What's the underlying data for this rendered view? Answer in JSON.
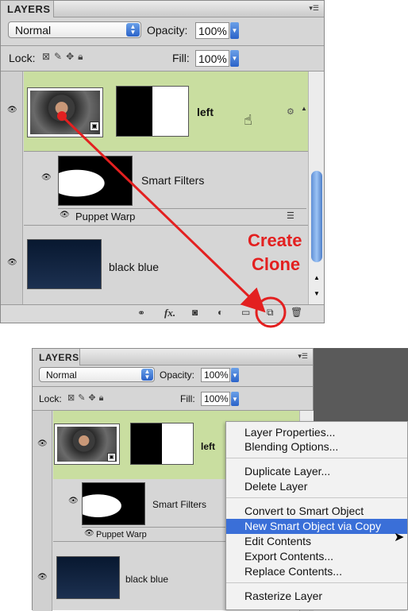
{
  "panel1": {
    "tab_label": "LAYERS",
    "blend_mode": "Normal",
    "opacity_label": "Opacity:",
    "opacity_value": "100%",
    "lock_label": "Lock:",
    "fill_label": "Fill:",
    "fill_value": "100%",
    "layers": {
      "left_name": "left",
      "smart_filters": "Smart Filters",
      "puppet_warp": "Puppet Warp",
      "black_blue": "black blue"
    },
    "annotation": {
      "line1": "Create",
      "line2": "Clone"
    },
    "footer_fx": "fx."
  },
  "panel2": {
    "tab_label": "LAYERS",
    "blend_mode": "Normal",
    "opacity_label": "Opacity:",
    "opacity_value": "100%",
    "lock_label": "Lock:",
    "fill_label": "Fill:",
    "fill_value": "100%",
    "layers": {
      "left_name": "left",
      "smart_filters": "Smart Filters",
      "puppet_warp": "Puppet Warp",
      "black_blue": "black blue"
    }
  },
  "context_menu": {
    "items": [
      "Layer Properties...",
      "Blending Options...",
      "Duplicate Layer...",
      "Delete Layer",
      "Convert to Smart Object",
      "New Smart Object via Copy",
      "Edit Contents",
      "Export Contents...",
      "Replace Contents...",
      "Rasterize Layer"
    ],
    "highlighted_index": 5
  },
  "colors": {
    "selected_row": "#c9dea0",
    "annotation_red": "#e32020",
    "menu_highlight": "#3a6fd8"
  },
  "icons": [
    "eye-icon",
    "link-icon",
    "fx-icon",
    "mask-icon",
    "adjustment-icon",
    "folder-icon",
    "new-layer-icon",
    "trash-icon",
    "hand-cursor-icon",
    "arrow-cursor-icon",
    "smart-object-badge-icon"
  ]
}
